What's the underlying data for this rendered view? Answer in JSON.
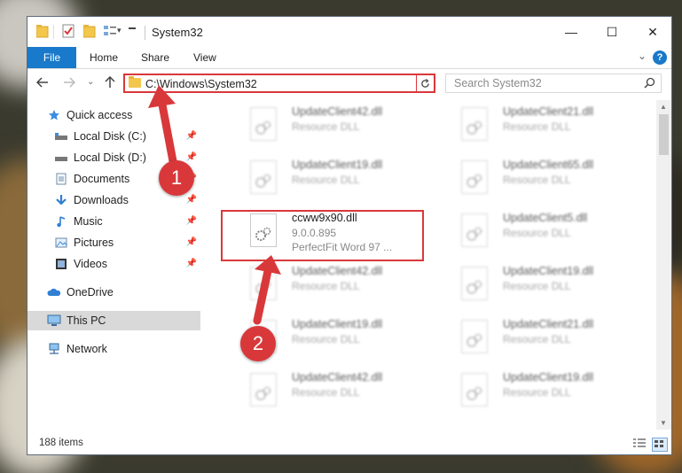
{
  "window": {
    "title": "System32",
    "minimize": "—",
    "maximize": "☐",
    "close": "✕"
  },
  "ribbon": {
    "file": "File",
    "home": "Home",
    "share": "Share",
    "view": "View",
    "help": "?"
  },
  "address": {
    "path": "C:\\Windows\\System32"
  },
  "search": {
    "placeholder": "Search System32"
  },
  "sidebar": {
    "items": [
      {
        "label": "Quick access",
        "icon": "star-icon"
      },
      {
        "label": "Local Disk (C:)",
        "icon": "drive-icon",
        "pinned": true
      },
      {
        "label": "Local Disk (D:)",
        "icon": "drive-icon",
        "pinned": true
      },
      {
        "label": "Documents",
        "icon": "documents-icon",
        "pinned": true
      },
      {
        "label": "Downloads",
        "icon": "downloads-icon",
        "pinned": true
      },
      {
        "label": "Music",
        "icon": "music-icon",
        "pinned": true
      },
      {
        "label": "Pictures",
        "icon": "pictures-icon",
        "pinned": true
      },
      {
        "label": "Videos",
        "icon": "videos-icon",
        "pinned": true
      },
      {
        "label": "OneDrive",
        "icon": "onedrive-icon"
      },
      {
        "label": "This PC",
        "icon": "pc-icon",
        "selected": true
      },
      {
        "label": "Network",
        "icon": "network-icon"
      }
    ]
  },
  "files": {
    "left": [
      {
        "name": "UpdateClient42.dll",
        "desc": "Resource DLL"
      },
      {
        "name": "UpdateClient19.dll",
        "desc": "Resource DLL"
      },
      {
        "name": "ccww9x90.dll",
        "desc": "9.0.0.895",
        "desc2": "PerfectFit Word 97 ..."
      },
      {
        "name": "UpdateClient42.dll",
        "desc": "Resource DLL"
      },
      {
        "name": "UpdateClient19.dll",
        "desc": "Resource DLL"
      },
      {
        "name": "UpdateClient42.dll",
        "desc": "Resource DLL"
      }
    ],
    "right": [
      {
        "name": "UpdateClient21.dll",
        "desc": "Resource DLL"
      },
      {
        "name": "UpdateClient65.dll",
        "desc": "Resource DLL"
      },
      {
        "name": "UpdateClient5.dll",
        "desc": "Resource DLL"
      },
      {
        "name": "UpdateClient19.dll",
        "desc": "Resource DLL"
      },
      {
        "name": "UpdateClient21.dll",
        "desc": "Resource DLL"
      },
      {
        "name": "UpdateClient19.dll",
        "desc": "Resource DLL"
      }
    ]
  },
  "status": {
    "count": "188 items"
  },
  "annotations": {
    "step1": "1",
    "step2": "2",
    "color": "#d9383b"
  }
}
